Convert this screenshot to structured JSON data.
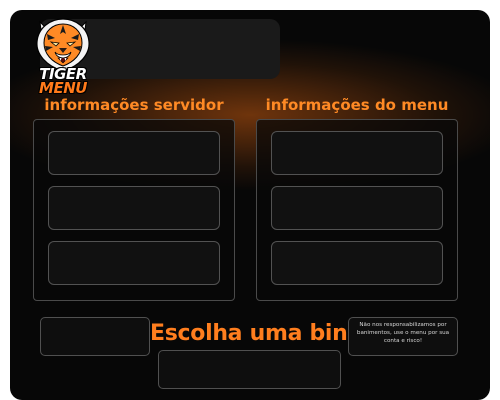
{
  "logo": {
    "line1": "TIGER",
    "line2": "MENU",
    "icon": "tiger-head-icon",
    "accent": "#ff7a1a"
  },
  "sections": {
    "server_info": {
      "title": "informações servidor",
      "slots": [
        "",
        "",
        ""
      ]
    },
    "menu_info": {
      "title": "informações do menu",
      "slots": [
        "",
        "",
        ""
      ]
    }
  },
  "bind": {
    "title": "Escolha uma bind",
    "value": ""
  },
  "disclaimer": {
    "text": "Não nos responsabilizamos por banimentos, use o menu por sua conta e risco!"
  },
  "colors": {
    "background": "#070707",
    "accent": "#ff8a25",
    "border": "#4a4a4a"
  }
}
